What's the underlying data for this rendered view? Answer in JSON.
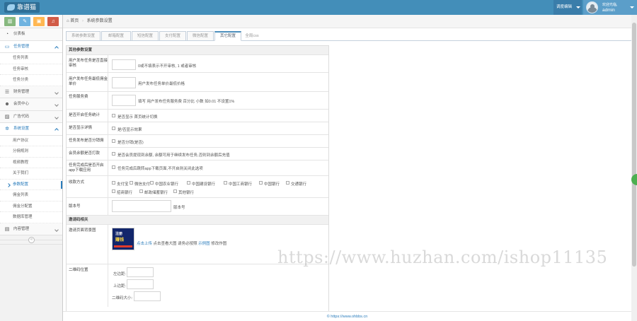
{
  "header": {
    "logo_text": "靠谱猫",
    "select_label": "调度编辑",
    "user_welcome": "欢迎光临,",
    "username": "admin"
  },
  "colors": {
    "topbar": "#438eb9",
    "accent": "#2b7dbc",
    "shortcut_green": "#87b87f",
    "shortcut_blue": "#6fb3e0",
    "shortcut_orange": "#ffb752",
    "shortcut_red": "#d15b47"
  },
  "sidebar": {
    "shortcuts": [
      "chart-icon",
      "pencil-icon",
      "users-icon",
      "bell-icon"
    ],
    "items": [
      {
        "label": "仪表板",
        "icon": "tachometer-icon"
      },
      {
        "label": "任务管理",
        "icon": "desktop-icon",
        "open": true,
        "children": [
          "任务列表",
          "任务审核",
          "任务分类"
        ]
      },
      {
        "label": "财务管理",
        "icon": "list-icon"
      },
      {
        "label": "会员中心",
        "icon": "users-icon"
      },
      {
        "label": "广告代码",
        "icon": "picture-icon"
      },
      {
        "label": "系统设置",
        "icon": "cog-icon",
        "open": true,
        "children": [
          "用户协议",
          "分佣规则",
          "视频教程",
          "关于我们",
          "参数配置",
          "佣金列表",
          "佣金分配置",
          "数据库管理"
        ],
        "active_child": "参数配置"
      },
      {
        "label": "内容管理",
        "icon": "file-icon"
      }
    ]
  },
  "breadcrumb": {
    "home": "首页",
    "current": "系统参数设置"
  },
  "tabs": [
    {
      "label": "系统参数设置"
    },
    {
      "label": "邮箱配置"
    },
    {
      "label": "短信配置"
    },
    {
      "label": "支付配置"
    },
    {
      "label": "微信配置"
    },
    {
      "label": "其它配置",
      "active": true
    },
    {
      "label": "全局css"
    }
  ],
  "form": {
    "section1_title": "其他参数设置",
    "row1": {
      "label": "用户发布任务是否直接审核",
      "note": "0或不填表示不开审核, 1 或者审核"
    },
    "row2": {
      "label": "用户发布任务最低佣金单价",
      "note": "用户发布任务单价最低价格"
    },
    "row3": {
      "label": "任务服务费",
      "note": "填写 用户发布任务服务费 百分比 小数 如0.01 不设置1%"
    },
    "row4": {
      "label": "是否开启任务统计",
      "note": "是否显示 首页统计切换"
    },
    "row5": {
      "label": "是否显示详情",
      "note": "是/否显示效果"
    },
    "row6": {
      "label": "任务发布是否分销佣",
      "note": "是否分销(是否)"
    },
    "row7": {
      "label": "会员余额是否打款",
      "note": "是否会员提现到余额, 余额可用于继续发布任务,否则到余额后充值"
    },
    "row8": {
      "label": "任务完成后是否开启app下载应用",
      "note": "任务完成后跳转app下载页面,不开启则关闭此选项"
    },
    "row9": {
      "label": "收款方式",
      "options": [
        "支付宝",
        "微信支付",
        "中国农业银行",
        "中国建设银行",
        "中国工商银行",
        "中国银行",
        "交通银行",
        "招商银行",
        "邮政储蓄银行",
        "其他银行"
      ]
    },
    "row10": {
      "label": "版本号",
      "suffix": "版本号"
    },
    "section2_title": "邀请码相关",
    "row11": {
      "label": "邀请页面背景图",
      "qr_title": "注册",
      "qr_subtitle": "赚钱",
      "upload_link": "点击上传",
      "view_text": "点击查看大图",
      "hint_text": "请务必按照",
      "example_link": "示例图",
      "edit_text": "修改作图"
    },
    "row12": {
      "label": "二维码位置",
      "left_label": "左边距:",
      "top_label": "上边距:",
      "size_label": "二维码大小:"
    }
  },
  "watermark": "https://www.huzhan.com/ishop11135",
  "footer": "© https://www.ohbbs.cn"
}
